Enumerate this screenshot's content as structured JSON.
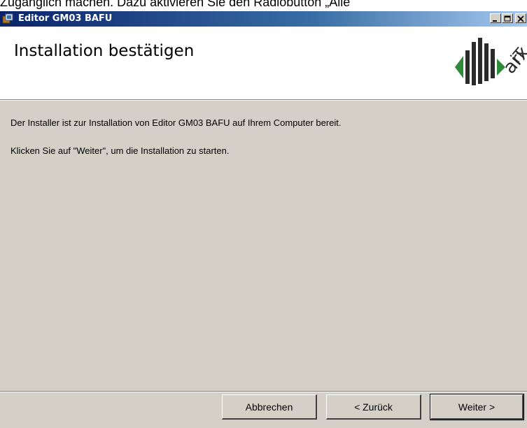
{
  "background_text": "Zugänglich machen. Dazu aktivieren Sie den Radiobutton „Alle",
  "window": {
    "title": "Editor GM03 BAFU",
    "titlebar_colors": [
      "#0a246a",
      "#a6caf0"
    ]
  },
  "header": {
    "title": "Installation bestätigen",
    "logo_text": "arx iT",
    "logo_color": "#2a2a2a",
    "logo_accent": "#2e8b3a"
  },
  "content": {
    "line1": "Der Installer ist zur Installation von Editor GM03 BAFU auf Ihrem Computer bereit.",
    "line2": "Klicken Sie auf \"Weiter\", um die Installation zu starten."
  },
  "footer": {
    "cancel_label": "Abbrechen",
    "back_label": "< Zurück",
    "next_label": "Weiter >"
  }
}
